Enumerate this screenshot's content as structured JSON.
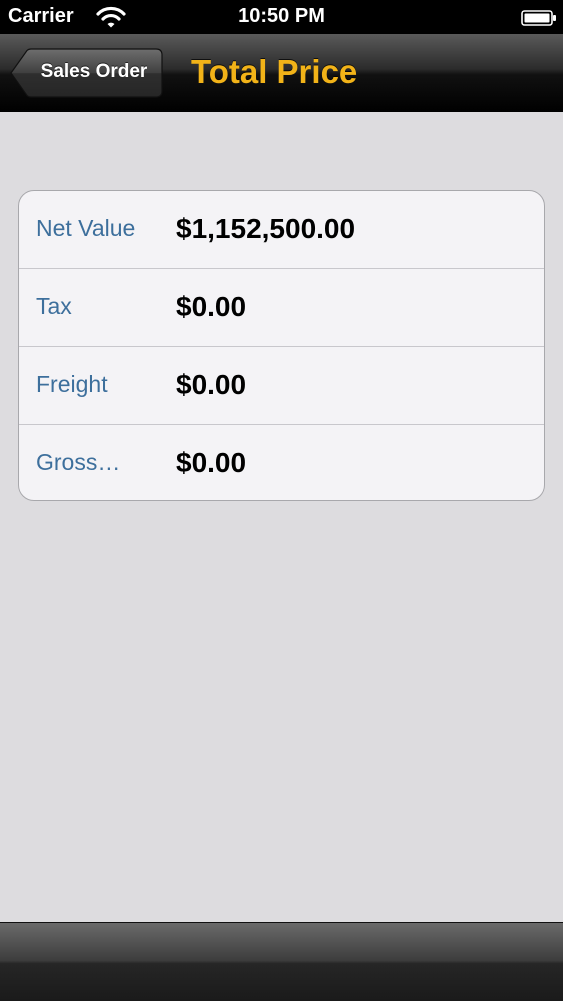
{
  "status_bar": {
    "carrier": "Carrier",
    "time": "10:50 PM",
    "icons": [
      "wifi-icon",
      "battery-icon"
    ]
  },
  "nav_bar": {
    "back_label": "Sales Order",
    "title": "Total Price",
    "title_color": "#f2b318"
  },
  "price_table": {
    "rows": [
      {
        "label": "Net Value",
        "value": "$1,152,500.00"
      },
      {
        "label": "Tax",
        "value": "$0.00"
      },
      {
        "label": "Freight",
        "value": "$0.00"
      },
      {
        "label": "Gross…",
        "value": "$0.00"
      }
    ],
    "label_color": "#3d6f9c"
  }
}
